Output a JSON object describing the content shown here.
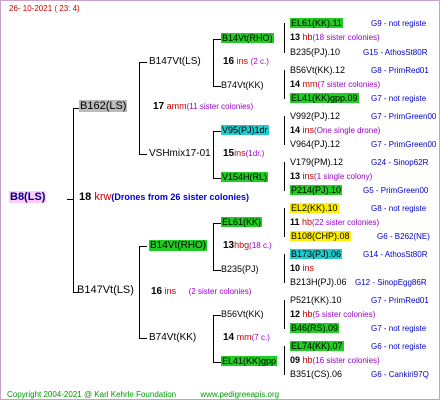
{
  "header": "26- 10-2021 ( 23: 4)",
  "root": {
    "name": "B8(LS)",
    "num": "18",
    "race": "krw",
    "note": "(Drones from 26 sister colonies)"
  },
  "sire": {
    "name": "B162(LS)",
    "num": "17",
    "race": "amm",
    "note": "(11 sister colonies)"
  },
  "dam": {
    "name": "B147Vt(LS)",
    "num": "16",
    "race": "ins",
    "note": "(2 sister colonies)"
  },
  "g2": [
    {
      "name": "B147Vt(LS)",
      "num": "16",
      "race": "ins",
      "note": "(2 c.)"
    },
    {
      "name": "VSHmix17-01",
      "num": "15",
      "race": "ins",
      "note": "(1dr.)"
    },
    {
      "name": "B14Vt(RHO)",
      "num": "13",
      "race": "hbg",
      "note": "(18 c.)"
    },
    {
      "name": "B74Vt(KK)",
      "num": "14",
      "race": "mm",
      "note": "(7 c.)"
    }
  ],
  "g3": [
    {
      "name": "B14Vt(RHO)"
    },
    {
      "name": "B74Vt(KK)"
    },
    {
      "name": "V95(PJ)1dr"
    },
    {
      "name": "V154H(RL)"
    },
    {
      "name": "EL61(KK)"
    },
    {
      "name": "B235(PJ)"
    },
    {
      "name": "B56Vt(KK)"
    },
    {
      "name": "EL41(KK)gpp"
    }
  ],
  "g4": [
    {
      "name": "EL61(KK).11",
      "tag": "G9 - not registe"
    },
    {
      "num": "13",
      "race": "hb",
      "note": "(18 sister colonies)"
    },
    {
      "name": "B235(PJ).10",
      "tag": "G15 - AthosSt80R"
    },
    {
      "name": "B56Vt(KK).12",
      "tag": "G8 - PrimRed01"
    },
    {
      "num": "14",
      "race": "mm",
      "note": "(7 sister colonies)"
    },
    {
      "name": "EL41(KK)gpp.09",
      "tag": "G7 - not registe"
    },
    {
      "name": "V992(PJ).12",
      "tag": "G7 - PrimGreen00"
    },
    {
      "num": "14",
      "race": "ins",
      "note": "(One single drone)"
    },
    {
      "name": "V964(PJ).12",
      "tag": "G7 - PrimGreen00"
    },
    {
      "name": "V179(PM).12",
      "tag": "G24 - Sinop62R"
    },
    {
      "num": "13",
      "race": "ins",
      "note": "(1 single colony)"
    },
    {
      "name": "P214(PJ).10",
      "tag": "G5 - PrimGreen00"
    },
    {
      "name": "EL2(KK).10",
      "tag": "G8 - not registe"
    },
    {
      "num": "11",
      "race": "hb",
      "note": "(22 sister colonies)"
    },
    {
      "name": "B108(CHP).08",
      "tag": "G6 - B262(NE)"
    },
    {
      "name": "B173(PJ).06",
      "tag": "G14 - AthosSt80R"
    },
    {
      "num": "10",
      "race": "ins",
      "note": ""
    },
    {
      "name": "B213H(PJ).06",
      "tag": "G12 - SinopEgg86R"
    },
    {
      "name": "P521(KK).10",
      "tag": "G7 - PrimRed01"
    },
    {
      "num": "12",
      "race": "hb",
      "note": "(5 sister colonies)"
    },
    {
      "name": "B46(RS).09",
      "tag": "G7 - not registe"
    },
    {
      "name": "EL74(KK).07",
      "tag": "G6 - not registe"
    },
    {
      "num": "09",
      "race": "hb",
      "note": "(16 sister colonies)"
    },
    {
      "name": "B351(CS).06",
      "tag": "G6 - Cankiri97Q"
    }
  ],
  "footer_left": "Copyright 2004-2021 @ Karl Kehrle Foundation",
  "footer_right": "www.pedigreeapis.org"
}
